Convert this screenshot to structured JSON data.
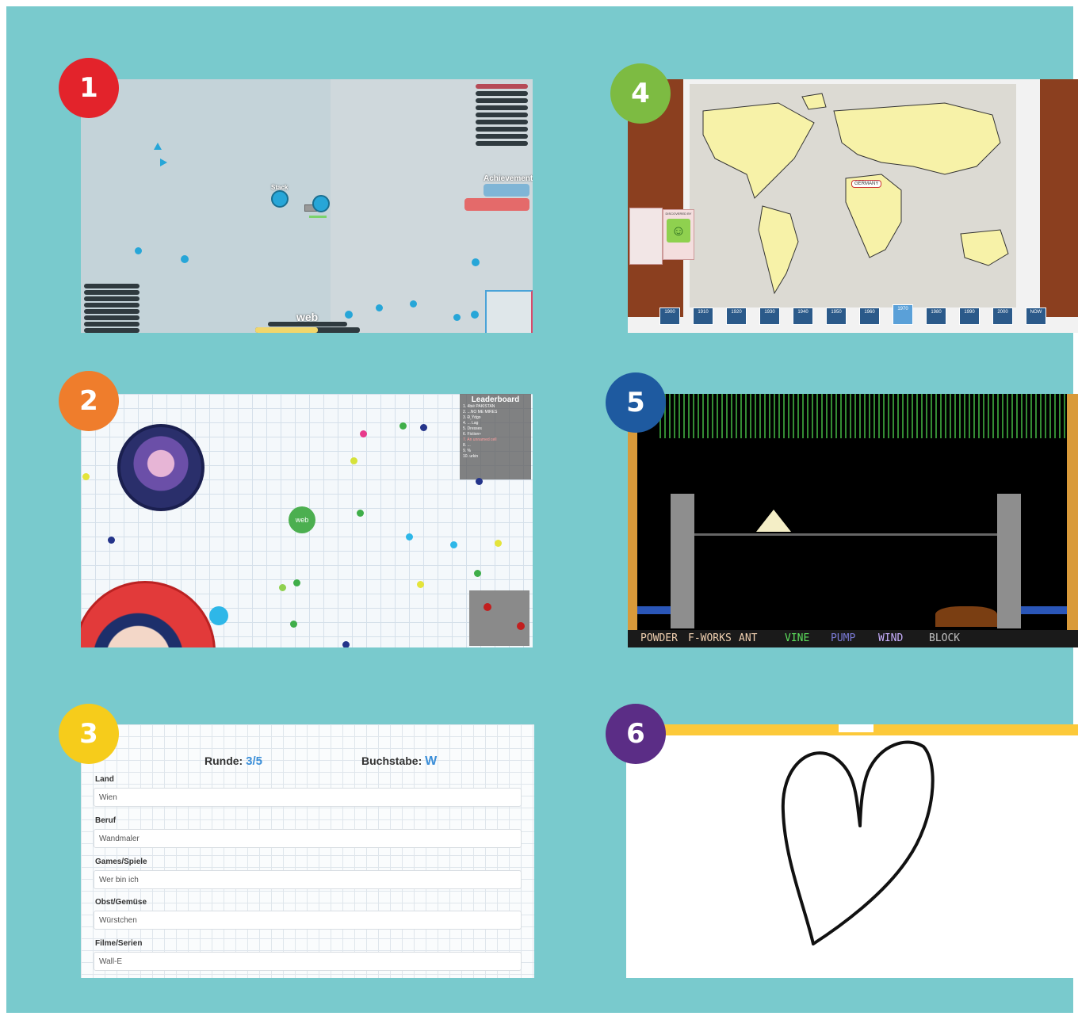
{
  "badges": [
    {
      "number": "1",
      "color": "#e3232b"
    },
    {
      "number": "2",
      "color": "#ef7d2c"
    },
    {
      "number": "3",
      "color": "#f6cc1b"
    },
    {
      "number": "4",
      "color": "#7dbb42"
    },
    {
      "number": "5",
      "color": "#1e5aa0"
    },
    {
      "number": "6",
      "color": "#5b2d86"
    }
  ],
  "panel1": {
    "achievements_title": "Achievements",
    "player_name": "web",
    "enemy_name": "Stack"
  },
  "panel2": {
    "leaderboard_title": "Leaderboard",
    "leaderboard_items": [
      "1. 4bié PAKISTAN",
      "2. ...NO ME MIRES",
      "3. Ð¸Ýdgo",
      "4. ... Lag",
      "5. Dresses",
      "6. Fiction+",
      "7. An unnamed cell",
      "8. ...",
      "9. %",
      "10. urkin"
    ],
    "player_cell": "web"
  },
  "panel3": {
    "round_label": "Runde:",
    "round_value": "3/5",
    "letter_label": "Buchstabe:",
    "letter_value": "W",
    "fields": [
      {
        "label": "Land",
        "value": "Wien"
      },
      {
        "label": "Beruf",
        "value": "Wandmaler"
      },
      {
        "label": "Games/Spiele",
        "value": "Wer bin ich"
      },
      {
        "label": "Obst/Gemüse",
        "value": "Würstchen"
      },
      {
        "label": "Filme/Serien",
        "value": "Wall-E"
      }
    ]
  },
  "panel4": {
    "country_label": "GERMANY",
    "discovered_by": "DISCOVERED BY",
    "decades": [
      "1900",
      "1910",
      "1920",
      "1930",
      "1940",
      "1950",
      "1960",
      "1970",
      "1980",
      "1990",
      "2000",
      "NOW"
    ],
    "active_decade": "1970"
  },
  "panel5": {
    "menu": [
      {
        "label": "POWDER",
        "color": "#f0d0b0"
      },
      {
        "label": "F-WORKS",
        "color": "#f0d0b0"
      },
      {
        "label": "ANT",
        "color": "#f0d0b0"
      },
      {
        "label": "VINE",
        "color": "#5de05d"
      },
      {
        "label": "PUMP",
        "color": "#7b7bd6"
      },
      {
        "label": "WIND",
        "color": "#c9b0ff"
      },
      {
        "label": "BLOCK",
        "color": "#c0c0c0"
      }
    ]
  }
}
